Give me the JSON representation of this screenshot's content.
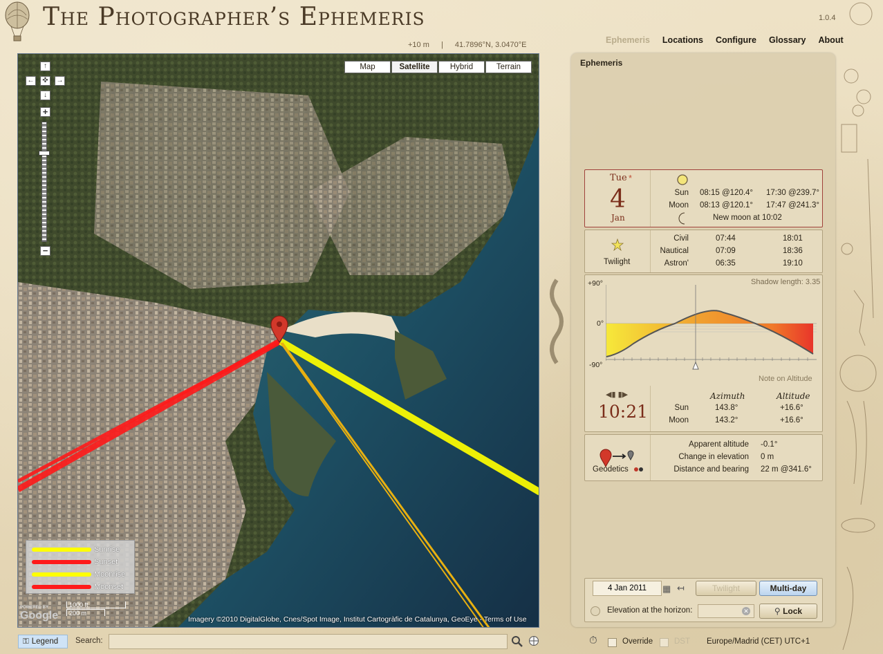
{
  "app": {
    "title": "The Photographer’s Ephemeris",
    "version": "1.0.4"
  },
  "location_bar": {
    "elevation": "+10 m",
    "separator": "|",
    "coordinates": "41.7896°N, 3.0470°E"
  },
  "nav": {
    "items": [
      {
        "label": "Ephemeris",
        "active": true
      },
      {
        "label": "Locations"
      },
      {
        "label": "Configure"
      },
      {
        "label": "Glossary"
      },
      {
        "label": "About"
      }
    ]
  },
  "map": {
    "types": [
      {
        "label": "Map"
      },
      {
        "label": "Satellite",
        "selected": true
      },
      {
        "label": "Hybrid"
      },
      {
        "label": "Terrain"
      }
    ],
    "legend": [
      {
        "label": "Sunrise",
        "color": "#ffff00"
      },
      {
        "label": "Sunset",
        "color": "#ff1a1a"
      },
      {
        "label": "Moonrise",
        "color": "#ffff00"
      },
      {
        "label": "Moonset",
        "color": "#ff1a1a"
      }
    ],
    "scale": {
      "imperial": "1000 ft",
      "metric": "200 m"
    },
    "powered_by": "POWERED BY",
    "google": "Google",
    "attribution": "Imagery ©2010  DigitalGlobe, Cnes/Spot Image, Institut Cartogràfic de Catalunya, GeoEye - Terms of Use"
  },
  "bottom": {
    "legend_button": "Legend",
    "search_label": "Search:",
    "search_value": ""
  },
  "panel": {
    "title": "Ephemeris",
    "date": {
      "weekday": "Tue",
      "marker": "*",
      "day": "4",
      "month": "Jan"
    },
    "sun": {
      "label": "Sun",
      "rise": "08:15 @120.4°",
      "set": "17:30 @239.7°"
    },
    "moon": {
      "label": "Moon",
      "rise": "08:13 @120.1°",
      "set": "17:47 @241.3°",
      "phase": "New moon at 10:02"
    },
    "twilight": {
      "label": "Twilight",
      "rows": [
        {
          "name": "Civil",
          "morning": "07:44",
          "evening": "18:01"
        },
        {
          "name": "Nautical",
          "morning": "07:09",
          "evening": "18:36"
        },
        {
          "name": "Astron'",
          "morning": "06:35",
          "evening": "19:10"
        }
      ]
    },
    "chart": {
      "shadow": "Shadow length: 3.35",
      "y_top": "+90°",
      "y_mid": "0°",
      "y_bot": "-90°",
      "note": "Note on Altitude"
    },
    "time": {
      "value": "10:21",
      "azimuth_header": "Azimuth",
      "altitude_header": "Altitude",
      "rows": [
        {
          "name": "Sun",
          "azimuth": "143.8°",
          "altitude": "+16.6°"
        },
        {
          "name": "Moon",
          "azimuth": "143.2°",
          "altitude": "+16.6°"
        }
      ]
    },
    "geodetics": {
      "label": "Geodetics",
      "rows": [
        {
          "name": "Apparent altitude",
          "value": "-0.1°"
        },
        {
          "name": "Change in elevation",
          "value": "0 m"
        },
        {
          "name": "Distance and bearing",
          "value": "22 m @341.6°"
        }
      ]
    },
    "controls": {
      "date_value": "4 Jan 2011",
      "twilight_btn": "Twilight",
      "multiday_btn": "Multi-day",
      "elev_label": "Elevation at the horizon:",
      "elev_value": "",
      "lock_btn": "Lock"
    },
    "footer": {
      "override": "Override",
      "dst": "DST",
      "timezone": "Europe/Madrid (CET) UTC+1"
    }
  }
}
